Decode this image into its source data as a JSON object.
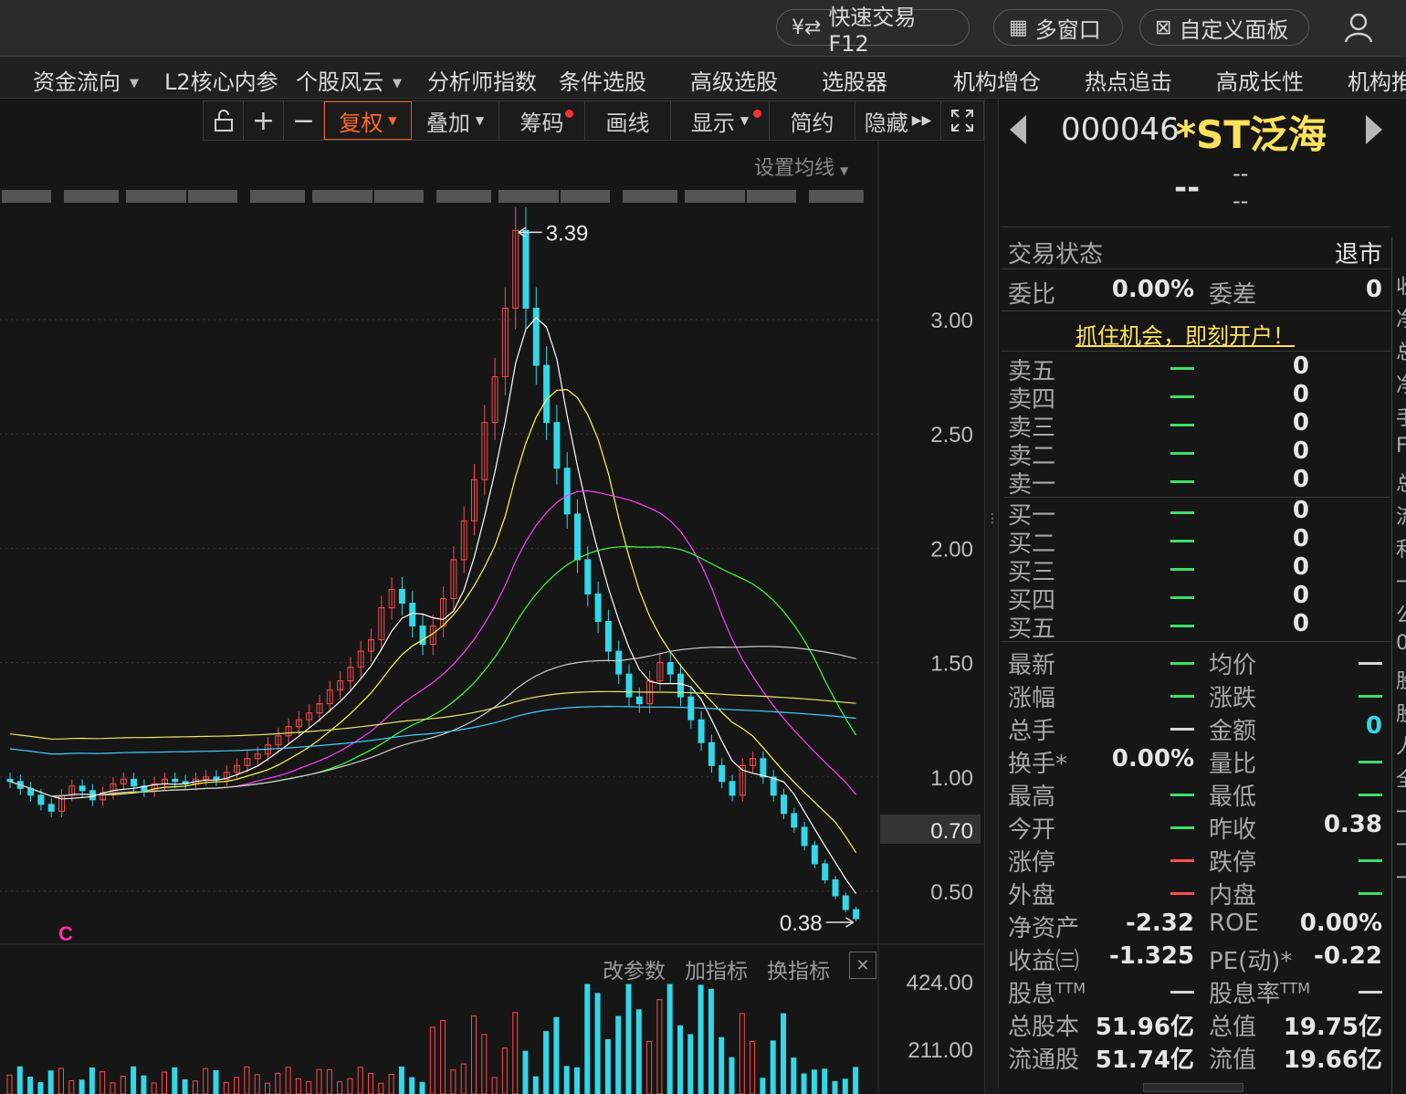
{
  "topbar": {
    "quick_trade": "快速交易F12",
    "multi_window": "多窗口",
    "custom_panel": "自定义面板"
  },
  "nav": [
    {
      "label": "资金流向",
      "dropdown": true
    },
    {
      "label": "L2核心内参",
      "dropdown": false
    },
    {
      "label": "个股风云",
      "dropdown": true
    },
    {
      "label": "分析师指数",
      "dropdown": false
    },
    {
      "label": "条件选股",
      "dropdown": false
    },
    {
      "label": "高级选股",
      "dropdown": false
    },
    {
      "label": "选股器",
      "dropdown": false
    },
    {
      "label": "机构增仓",
      "dropdown": false
    },
    {
      "label": "热点追击",
      "dropdown": false
    },
    {
      "label": "高成长性",
      "dropdown": false
    },
    {
      "label": "机构推",
      "dropdown": false
    }
  ],
  "toolbar": {
    "fuquan": "复权",
    "diejia": "叠加",
    "chouma": "筹码",
    "huaxian": "画线",
    "xianshi": "显示",
    "jianyue": "简约",
    "yincang": "隐藏"
  },
  "chart": {
    "ma_settings": "设置均线",
    "high_label": "3.39",
    "low_label": "0.38",
    "current_price_tag": "0.70",
    "event_marker": "C",
    "price_axis": [
      "3.00",
      "2.50",
      "2.00",
      "1.50",
      "1.00",
      "0.50"
    ],
    "vol_axis": [
      "424.00",
      "211.00"
    ],
    "vol_menu": [
      "改参数",
      "加指标",
      "换指标"
    ],
    "colors": {
      "up": "#ff4a4a",
      "down": "#33d7e8",
      "ma5": "#ffffff",
      "ma10": "#ffff40",
      "ma20": "#ff40ff",
      "ma30": "#40ff40",
      "ma60": "#cccccc",
      "ma120": "#40d0ff",
      "ma250": "#e8e86a"
    }
  },
  "chart_data": {
    "type": "candlestick",
    "title": "",
    "ylim": [
      0.3,
      3.6
    ],
    "high": 3.39,
    "low": 0.38,
    "price_ticks": [
      3.0,
      2.5,
      2.0,
      1.5,
      1.0,
      0.5
    ],
    "current_price": 0.7,
    "closes": [
      0.98,
      0.95,
      0.92,
      0.88,
      0.85,
      0.92,
      0.96,
      0.94,
      0.9,
      0.93,
      0.97,
      0.99,
      0.96,
      0.94,
      0.97,
      0.99,
      0.98,
      0.97,
      0.99,
      1.0,
      0.99,
      1.02,
      1.05,
      1.08,
      1.1,
      1.14,
      1.18,
      1.22,
      1.25,
      1.28,
      1.32,
      1.38,
      1.42,
      1.48,
      1.55,
      1.6,
      1.74,
      1.82,
      1.76,
      1.66,
      1.58,
      1.66,
      1.78,
      1.95,
      2.12,
      2.3,
      2.55,
      2.75,
      3.05,
      3.39,
      3.05,
      2.8,
      2.55,
      2.35,
      2.15,
      1.95,
      1.8,
      1.68,
      1.55,
      1.45,
      1.35,
      1.32,
      1.42,
      1.5,
      1.45,
      1.35,
      1.25,
      1.15,
      1.05,
      0.98,
      0.92,
      1.05,
      1.08,
      1.0,
      0.92,
      0.84,
      0.78,
      0.7,
      0.62,
      0.55,
      0.48,
      0.42,
      0.38
    ],
    "ma_series": [
      {
        "name": "MA5"
      },
      {
        "name": "MA10"
      },
      {
        "name": "MA20"
      },
      {
        "name": "MA30"
      },
      {
        "name": "MA60"
      },
      {
        "name": "MA120"
      },
      {
        "name": "MA250"
      }
    ]
  },
  "quote": {
    "code": "000046",
    "name": "*ST泛海",
    "price": "--",
    "chg1": "--",
    "chg2": "--",
    "trade_status_label": "交易状态",
    "trade_status": "退市",
    "weibi_label": "委比",
    "weibi": "0.00%",
    "weicha_label": "委差",
    "weicha": "0",
    "open_account": "抓住机会，即刻开户！",
    "sell": [
      {
        "label": "卖五",
        "vol": "0"
      },
      {
        "label": "卖四",
        "vol": "0"
      },
      {
        "label": "卖三",
        "vol": "0"
      },
      {
        "label": "卖二",
        "vol": "0"
      },
      {
        "label": "卖一",
        "vol": "0"
      }
    ],
    "buy": [
      {
        "label": "买一",
        "vol": "0"
      },
      {
        "label": "买二",
        "vol": "0"
      },
      {
        "label": "买三",
        "vol": "0"
      },
      {
        "label": "买四",
        "vol": "0"
      },
      {
        "label": "买五",
        "vol": "0"
      }
    ],
    "stats": {
      "zuixin": "最新",
      "junjia": "均价",
      "zhangfu": "涨幅",
      "zhangdie": "涨跌",
      "zongshou": "总手",
      "jine": "金额",
      "jine_val": "0",
      "huanshou": "换手*",
      "huanshou_val": "0.00%",
      "liangbi": "量比",
      "zuigao": "最高",
      "zuidi": "最低",
      "jinkai": "今开",
      "zuoshou": "昨收",
      "zuoshou_val": "0.38",
      "zhangting": "涨停",
      "dieting": "跌停",
      "waipan": "外盘",
      "neipan": "内盘",
      "jingzichan": "净资产",
      "jingzichan_val": "-2.32",
      "roe": "ROE",
      "roe_val": "0.00%",
      "shouyi": "收益㈢",
      "shouyi_val": "-1.325",
      "pe": "PE(动)*",
      "pe_val": "-0.22",
      "guxi": "股息",
      "ttm": "TTM",
      "guxilv": "股息率",
      "zongguben": "总股本",
      "zongguben_val": "51.96亿",
      "zongzhi": "总值",
      "zongzhi_val": "19.75亿",
      "liutonggu": "流通股",
      "liutonggu_val": "51.74亿",
      "liuzhi": "流值",
      "liuzhi_val": "19.66亿"
    }
  },
  "right_edge": [
    "收",
    "净",
    "总",
    "净",
    "手",
    "F",
    "总",
    "流",
    "利",
    "一",
    "公",
    "0",
    "股",
    "股",
    "人",
    "全",
    "一",
    "一",
    "一"
  ]
}
